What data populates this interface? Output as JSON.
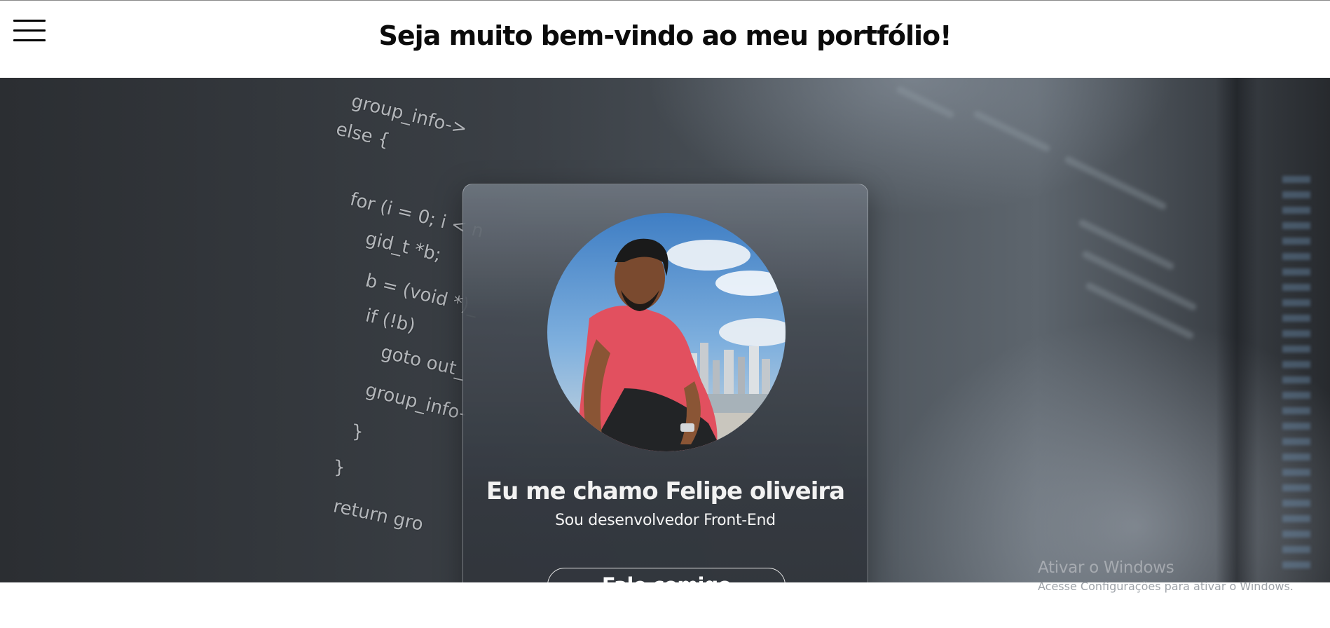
{
  "header": {
    "title": "Seja muito bem-vindo ao meu portfólio!",
    "menu_icon": "hamburger-menu-icon"
  },
  "hero": {
    "background": "blurred-code-editor-photo",
    "code_lines": [
      "group_info->",
      "else {",
      "for (i = 0; i < n",
      "gid_t *b;",
      "b = (void *)_",
      "if (!b)",
      "goto out_",
      "group_info-",
      "}",
      "}",
      "return gro"
    ]
  },
  "profile": {
    "photo": "profile-photo",
    "name": "Eu me chamo Felipe oliveira",
    "role": "Sou desenvolvedor Front-End",
    "contact_button": "Fale comigo"
  },
  "windows_watermark": {
    "title": "Ativar o Windows",
    "subtitle": "Acesse Configurações para ativar o Windows."
  },
  "colors": {
    "header_bg": "#ffffff",
    "title_text": "#0b0b0b",
    "card_text": "#f2f2f2",
    "hero_dark": "#2b2e32"
  }
}
